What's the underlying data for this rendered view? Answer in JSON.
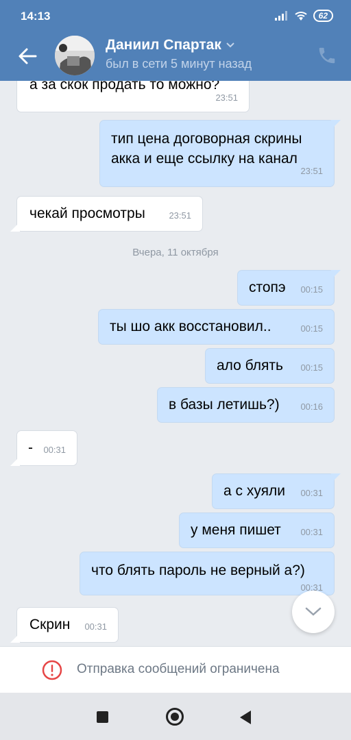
{
  "status_bar": {
    "time": "14:13",
    "battery": "62"
  },
  "header": {
    "name": "Даниил Спартак",
    "status": "был в сети 5 минут назад"
  },
  "messages": [
    {
      "dir": "in",
      "text": "а за скок продать то можно?",
      "time": "23:51"
    },
    {
      "dir": "out",
      "text": "тип цена договорная скрины акка и еще ссылку на канал",
      "time": "23:51"
    },
    {
      "dir": "in",
      "text": "чекай просмотры",
      "time": "23:51"
    },
    {
      "dir": "out",
      "text": "стопэ",
      "time": "00:15"
    },
    {
      "dir": "out",
      "text": "ты шо акк восстановил..",
      "time": "00:15"
    },
    {
      "dir": "out",
      "text": "ало блять",
      "time": "00:15"
    },
    {
      "dir": "out",
      "text": "в базы летишь?)",
      "time": "00:16"
    },
    {
      "dir": "in",
      "text": "-",
      "time": "00:31"
    },
    {
      "dir": "out",
      "text": "а с хуяли",
      "time": "00:31"
    },
    {
      "dir": "out",
      "text": "у меня пишет",
      "time": "00:31"
    },
    {
      "dir": "out",
      "text": "что блять пароль не верный а?)",
      "time": "00:31"
    },
    {
      "dir": "in",
      "text": "Скрин",
      "time": "00:31"
    }
  ],
  "date_separator": "Вчера, 11 октября",
  "restriction": {
    "text": "Отправка сообщений ограничена",
    "icon": "alert-circle-icon"
  },
  "colors": {
    "header": "#5181b8",
    "outgoing": "#cce4ff",
    "incoming": "#ffffff",
    "background": "#e9ecf0",
    "alert": "#e64646"
  }
}
